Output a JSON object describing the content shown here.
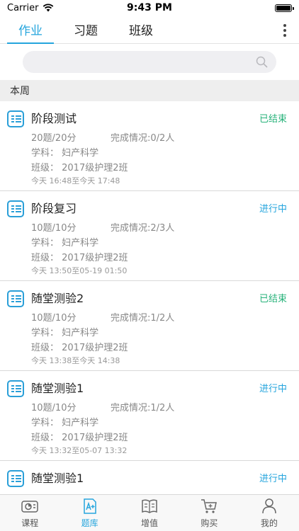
{
  "status_bar": {
    "carrier": "Carrier",
    "time": "9:43 PM"
  },
  "tabs": [
    {
      "label": "作业",
      "active": true
    },
    {
      "label": "习题",
      "active": false
    },
    {
      "label": "班级",
      "active": false
    }
  ],
  "search": {
    "placeholder": ""
  },
  "section": {
    "title": "本周"
  },
  "colors": {
    "accent": "#25a5dd",
    "ended": "#27b27a"
  },
  "items": [
    {
      "title": "阶段测试",
      "status": "已结束",
      "status_type": "ended",
      "questions": "20题/20分",
      "completion": "完成情况:0/2人",
      "subject": "学科：  妇产科学",
      "class": "班级：  2017级护理2班",
      "time": "今天 16:48至今天 17:48"
    },
    {
      "title": "阶段复习",
      "status": "进行中",
      "status_type": "running",
      "questions": "10题/10分",
      "completion": "完成情况:2/3人",
      "subject": "学科：  妇产科学",
      "class": "班级：  2017级护理2班",
      "time": "今天 13:50至05-19 01:50"
    },
    {
      "title": "随堂测验2",
      "status": "已结束",
      "status_type": "ended",
      "questions": "10题/10分",
      "completion": "完成情况:1/2人",
      "subject": "学科：  妇产科学",
      "class": "班级：  2017级护理2班",
      "time": "今天 13:38至今天 14:38"
    },
    {
      "title": "随堂测验1",
      "status": "进行中",
      "status_type": "running",
      "questions": "10题/10分",
      "completion": "完成情况:1/2人",
      "subject": "学科：  妇产科学",
      "class": "班级：  2017级护理2班",
      "time": "今天 13:32至05-07 13:32"
    },
    {
      "title": "随堂测验1",
      "status": "进行中",
      "status_type": "running",
      "questions": "",
      "completion": "",
      "subject": "",
      "class": "",
      "time": ""
    }
  ],
  "tabbar": [
    {
      "label": "课程",
      "icon": "course-icon",
      "active": false
    },
    {
      "label": "题库",
      "icon": "question-bank-icon",
      "active": true
    },
    {
      "label": "增值",
      "icon": "book-icon",
      "active": false
    },
    {
      "label": "购买",
      "icon": "cart-icon",
      "active": false
    },
    {
      "label": "我的",
      "icon": "user-icon",
      "active": false
    }
  ]
}
